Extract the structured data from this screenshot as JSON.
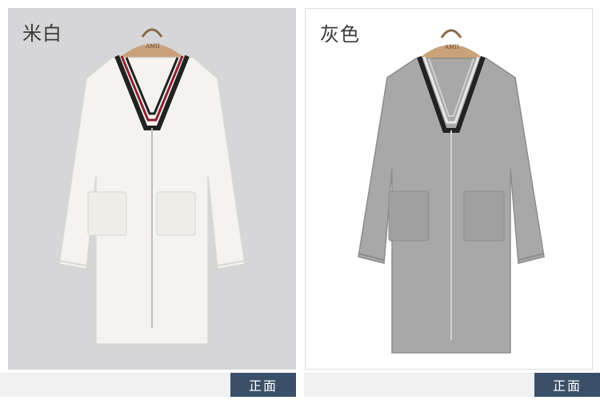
{
  "products": [
    {
      "color_name": "米白",
      "garment_color": "#f4f3ef",
      "view_label": "正面",
      "hanger_text": "AMII"
    },
    {
      "color_name": "灰色",
      "garment_color": "#a8a8a8",
      "view_label": "正面",
      "hanger_text": "AMII"
    }
  ],
  "colors": {
    "left_panel_bg": "#d6d6d8",
    "tag_bg": "#3a5068"
  }
}
